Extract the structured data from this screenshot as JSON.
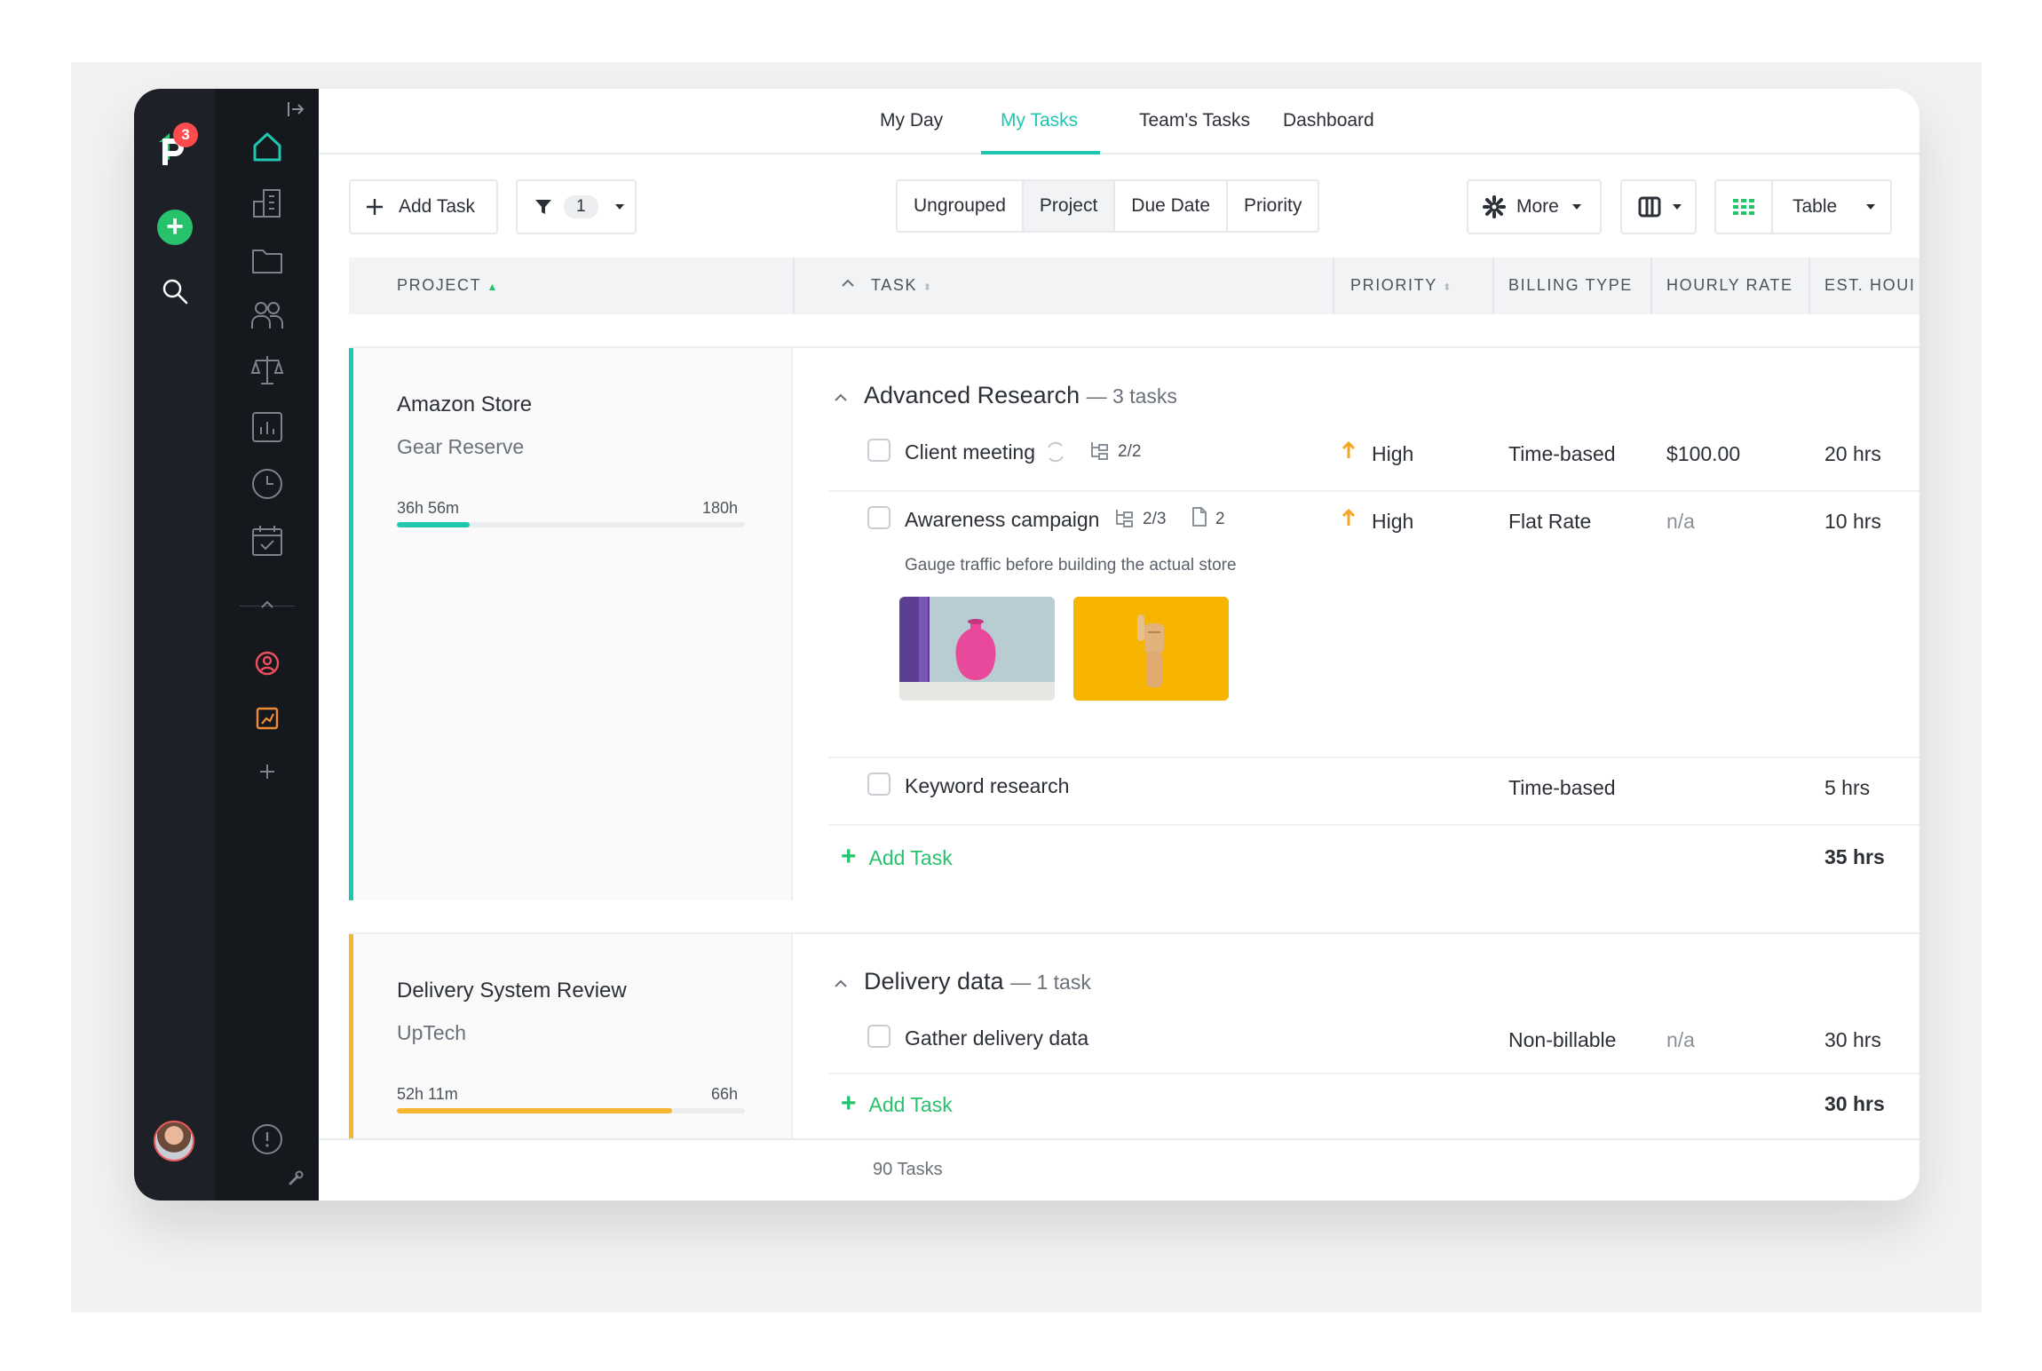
{
  "rail": {
    "logo_badge": "3",
    "icons": [
      "home-icon",
      "building-icon",
      "folder-icon",
      "team-icon",
      "scale-icon",
      "chart-icon",
      "clock-icon",
      "calendar-check-icon",
      "user-circle-icon",
      "chart-box-icon",
      "plus-icon",
      "info-icon",
      "wrench-icon"
    ]
  },
  "topnav": {
    "tabs": [
      {
        "label": "My Day"
      },
      {
        "label": "My Tasks",
        "active": true
      },
      {
        "label": "Team's Tasks"
      },
      {
        "label": "Dashboard"
      }
    ]
  },
  "toolbar": {
    "add_task": "Add Task",
    "filter_count": "1",
    "group_options": [
      "Ungrouped",
      "Project",
      "Due Date",
      "Priority"
    ],
    "selected_group": "Project",
    "more": "More",
    "view": "Table"
  },
  "columns": {
    "project": "PROJECT",
    "task": "TASK",
    "priority": "PRIORITY",
    "billing": "BILLING TYPE",
    "rate": "HOURLY RATE",
    "hours": "EST. HOUI"
  },
  "groups": [
    {
      "project": "Amazon Store",
      "client": "Gear Reserve",
      "progress_spent": "36h 56m",
      "progress_total": "180h",
      "progress_fraction": 0.21,
      "color": "#1fc7b0",
      "section": "Advanced Research",
      "section_count": "— 3 tasks",
      "tasks": [
        {
          "name": "Client meeting",
          "subtasks": "2/2",
          "priority": "High",
          "billing": "Time-based",
          "rate": "$100.00",
          "hours": "20 hrs"
        },
        {
          "name": "Awareness campaign",
          "subtasks": "2/3",
          "files": "2",
          "priority": "High",
          "billing": "Flat Rate",
          "rate": "n/a",
          "hours": "10 hrs",
          "description": "Gauge traffic before building the actual store"
        },
        {
          "name": "Keyword research",
          "billing": "Time-based",
          "hours": "5 hrs"
        }
      ],
      "add_task": "Add Task",
      "total": "35 hrs"
    },
    {
      "project": "Delivery System Review",
      "client": "UpTech",
      "progress_spent": "52h 11m",
      "progress_total": "66h",
      "progress_fraction": 0.79,
      "color": "#f5b731",
      "section": "Delivery data",
      "section_count": "— 1 task",
      "tasks": [
        {
          "name": "Gather delivery data",
          "billing": "Non-billable",
          "rate": "n/a",
          "hours": "30 hrs"
        }
      ],
      "add_task": "Add Task",
      "total": "30 hrs"
    }
  ],
  "footer": {
    "count": "90 Tasks"
  }
}
